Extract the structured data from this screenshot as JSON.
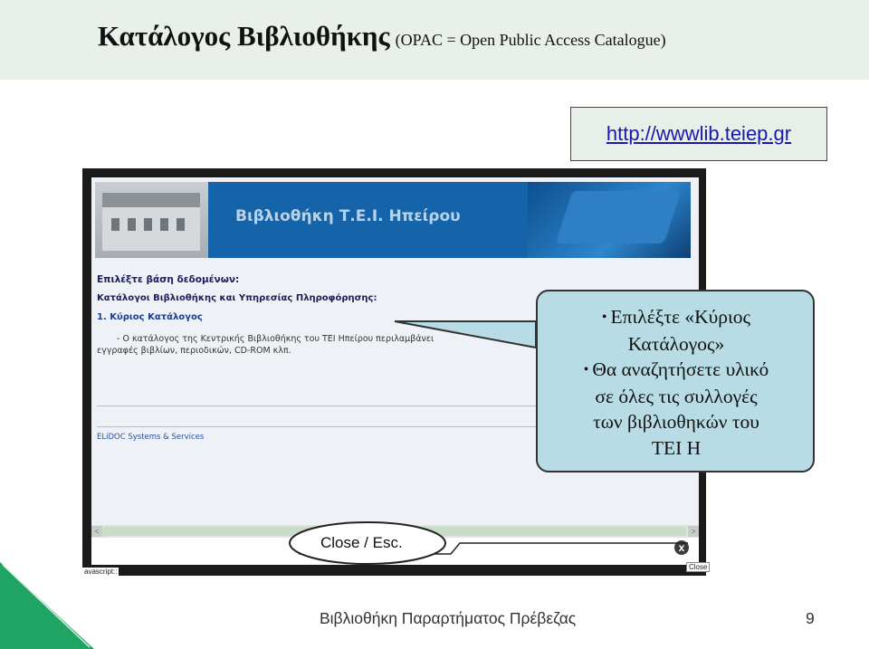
{
  "slide": {
    "title": "Κατάλογος Βιβλιοθήκης",
    "subtitle": "(OPAC = Open Public Access Catalogue)",
    "url": "http://wwwlib.teiep.gr",
    "callout": {
      "line1": "Επιλέξτε «Κύριος",
      "line2": "Κατάλογος»",
      "line3": "Θα αναζητήσετε υλικό",
      "line4": "σε όλες τις συλλογές",
      "line5": "των βιβλιοθηκών του",
      "line6": "ΤΕΙ Η"
    },
    "close_label": "Close / Esc.",
    "footer": "Βιβλιοθήκη Παραρτήματος Πρέβεζας",
    "page_number": "9"
  },
  "portal": {
    "header_title": "Βιβλιοθήκη Τ.Ε.Ι. Ηπείρου",
    "db_heading": "Επιλέξτε βάση δεδομένων:",
    "catalog_heading": "Κατάλογοι Βιβλιοθήκης και Υπηρεσίας Πληροφόρησης:",
    "main_catalog_link": "1. Κύριος Κατάλογος",
    "main_catalog_desc_1": "- Ο κατάλογος της Κεντρικής Βιβλιοθήκης του ΤΕΙ Ηπείρου περιλαμβάνει",
    "main_catalog_desc_2": "εγγραφές βιβλίων, περιοδικών, CD-ROM κλπ.",
    "vendor_link": "ELiDOC Systems & Services",
    "status_bar": "avascript::",
    "close_tooltip": "Close"
  },
  "icons": {
    "bullet": "•",
    "close": "x",
    "scroll_left": "<",
    "scroll_right": ">"
  },
  "colors": {
    "title_bar": "#e9efe9",
    "callout_fill": "#b7dce6",
    "url_link": "#1a1aa8",
    "banner_blue": "#1564aa",
    "corner_green": "#1fa463"
  }
}
